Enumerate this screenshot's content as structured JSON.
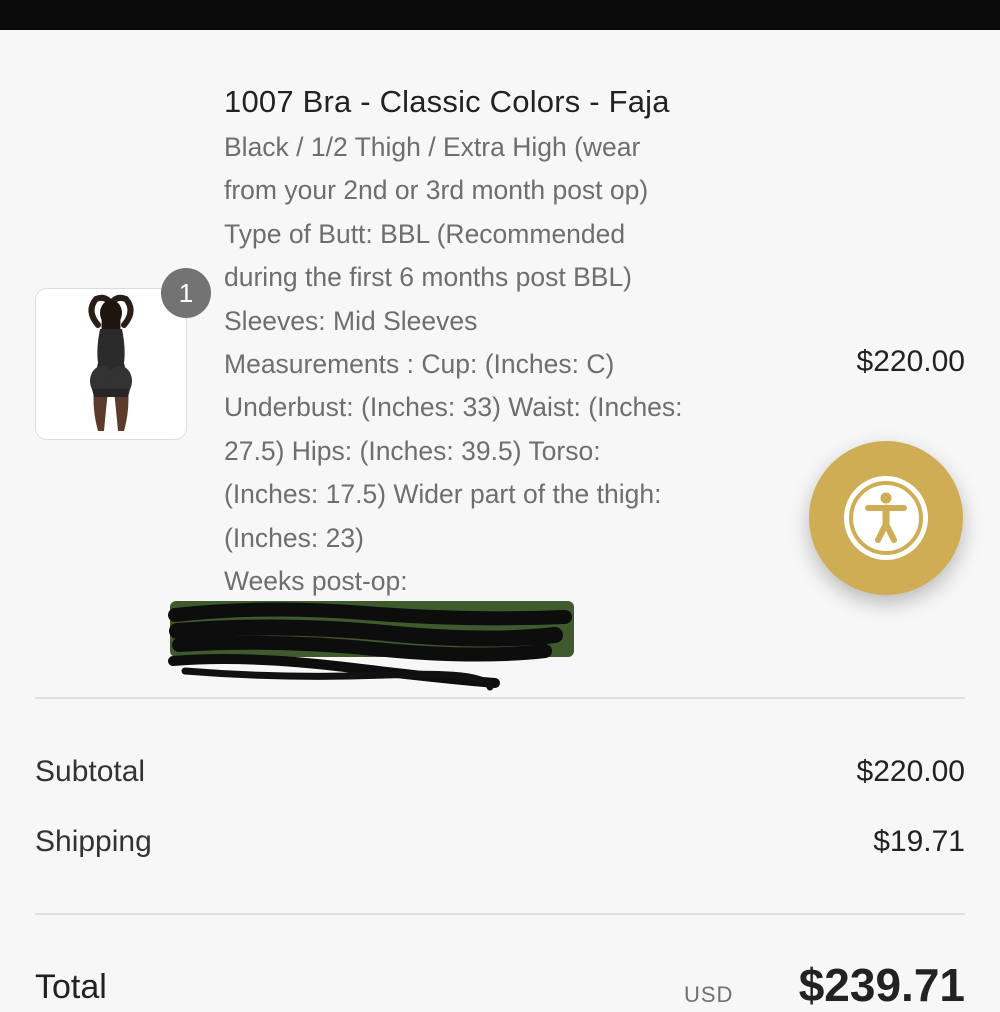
{
  "product": {
    "title": "1007 Bra - Classic Colors - Faja",
    "quantity": "1",
    "price": "$220.00",
    "details": [
      "Black / 1/2 Thigh / Extra High (wear",
      "from your 2nd or 3rd month post op)",
      "Type of Butt: BBL (Recommended",
      "during the first 6 months post BBL)",
      "Sleeves: Mid Sleeves",
      "Measurements : Cup: (Inches: C)",
      "Underbust: (Inches: 33) Waist: (Inches:",
      "27.5) Hips: (Inches: 39.5) Torso:",
      "(Inches: 17.5) Wider part of the thigh:",
      "(Inches: 23)",
      "Weeks post-op:"
    ],
    "image_icon": "product-photo"
  },
  "summary": {
    "subtotal_label": "Subtotal",
    "subtotal_value": "$220.00",
    "shipping_label": "Shipping",
    "shipping_value": "$19.71",
    "total_label": "Total",
    "total_currency": "USD",
    "total_value": "$239.71"
  },
  "accessibility": {
    "icon": "accessibility-icon",
    "color": "#cfad54"
  },
  "colors": {
    "top_bar": "#0b0b0b",
    "background": "#f7f7f7",
    "redaction_green": "#3f5b2e"
  }
}
